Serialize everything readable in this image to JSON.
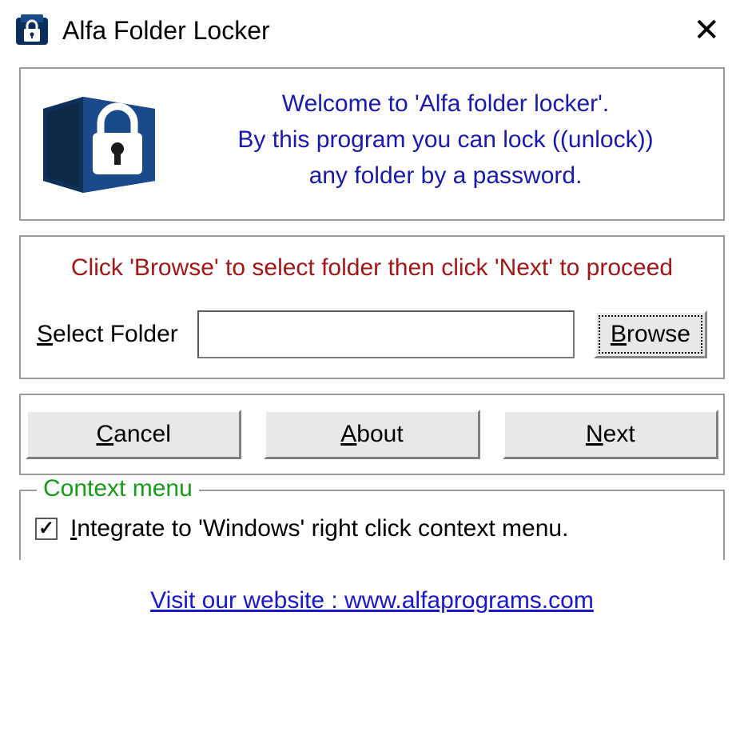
{
  "titlebar": {
    "title": "Alfa Folder Locker"
  },
  "welcome": {
    "line1": "Welcome to 'Alfa folder locker'.",
    "line2": "By this program you can lock ((unlock))",
    "line3": "any folder by a password."
  },
  "instruction": "Click 'Browse' to select folder then click 'Next' to proceed",
  "select": {
    "label_pre": "S",
    "label_rest": "elect Folder",
    "value": "",
    "browse_pre": "B",
    "browse_rest": "rowse"
  },
  "buttons": {
    "cancel_pre": "C",
    "cancel_rest": "ancel",
    "about_pre": "A",
    "about_rest": "bout",
    "next_pre": "N",
    "next_rest": "ext"
  },
  "context": {
    "legend": "Context menu",
    "checked": true,
    "label_pre": "I",
    "label_rest": "ntegrate to 'Windows' right click context menu."
  },
  "footer": {
    "text": "Visit our website : www.alfaprograms.com",
    "href": "#"
  }
}
